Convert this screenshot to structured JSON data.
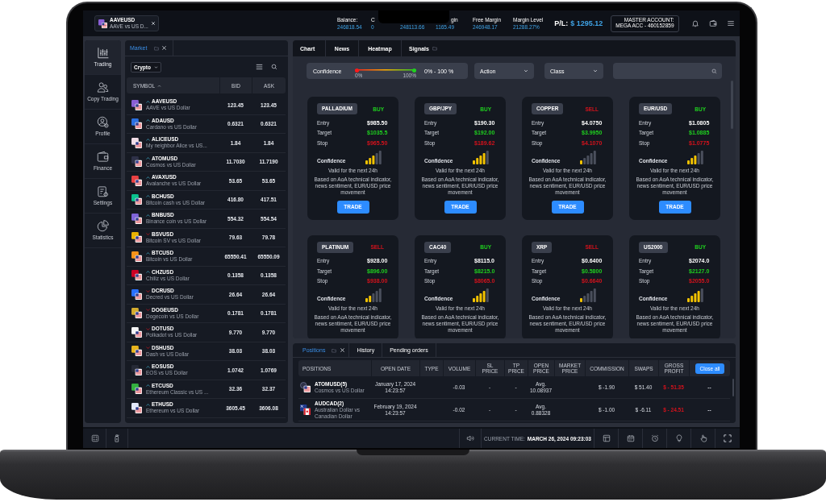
{
  "header": {
    "symbol_tab": {
      "symbol": "AAVEUSD",
      "description": "AAVE vs US D..."
    },
    "stats": [
      {
        "label": "Balance:",
        "value": "246818.54"
      },
      {
        "label": "C",
        "value": "0"
      },
      {
        "value": "248113.66"
      },
      {
        "label": "gin",
        "value": "1165.49"
      },
      {
        "label": "Free Margin",
        "value": "246948.17"
      },
      {
        "label": "Margin Level",
        "value": "21288.27%"
      }
    ],
    "pl": {
      "label": "P/L:",
      "value": "$ 1295.12"
    },
    "account": {
      "caption": "MASTER ACCOUNT:",
      "name": "MEGA ACC - 460152859"
    }
  },
  "sidebar": {
    "items": [
      {
        "label": "Trading",
        "selected": true
      },
      {
        "label": "Copy Trading",
        "selected": false
      },
      {
        "label": "Profile",
        "selected": false
      },
      {
        "label": "Finance",
        "selected": false
      },
      {
        "label": "Settings",
        "selected": false
      },
      {
        "label": "Statistics",
        "selected": false
      }
    ]
  },
  "market": {
    "tabs": [
      {
        "label": "Market",
        "selected": true
      }
    ],
    "filter": {
      "value": "Crypto"
    },
    "columns": [
      "SYMBOL",
      "BID",
      "ASK"
    ],
    "rows": [
      {
        "symbol": "AAVEUSD",
        "description": "AAVE vs US Dollar",
        "rising": true,
        "bid": "123.45",
        "ask": "123.45",
        "color": "#8a5fd6"
      },
      {
        "symbol": "ADAUSD",
        "description": "Cardano vs US Dollar",
        "rising": true,
        "bid": "0.6321",
        "ask": "0.6321",
        "color": "#2a6fe0"
      },
      {
        "symbol": "ALICEUSD",
        "description": "My neighbor Alice vs US...",
        "rising": true,
        "bid": "1.84",
        "ask": "1.84",
        "color": "#f2dde6"
      },
      {
        "symbol": "ATOMUSD",
        "description": "Cosmos vs US Dollar",
        "rising": true,
        "bid": "11.7030",
        "ask": "11.7190",
        "color": "#2e3148"
      },
      {
        "symbol": "AVAXUSD",
        "description": "Avalanche vs US Dollar",
        "rising": true,
        "bid": "53.65",
        "ask": "53.65",
        "color": "#e84142"
      },
      {
        "symbol": "BCHUSD",
        "description": "Bitcoin cash vs US Dollar",
        "rising": true,
        "bid": "416.80",
        "ask": "417.51",
        "color": "#0ac18e"
      },
      {
        "symbol": "BNBUSD",
        "description": "Binance coin vs US Dollar",
        "rising": true,
        "bid": "554.32",
        "ask": "554.54",
        "color": "#7f64d8"
      },
      {
        "symbol": "BSVUSD",
        "description": "Bitcoin SV vs US Dollar",
        "rising": false,
        "bid": "79.63",
        "ask": "79.78",
        "color": "#eab300"
      },
      {
        "symbol": "BTCUSD",
        "description": "Bitcoin vs US Dollar",
        "rising": true,
        "bid": "65550.41",
        "ask": "65550.09",
        "color": "#f7931a"
      },
      {
        "symbol": "CHZUSD",
        "description": "Chiliz vs US Dollar",
        "rising": true,
        "bid": "0.1358",
        "ask": "0.1358",
        "color": "#cd0124"
      },
      {
        "symbol": "DCRUSD",
        "description": "Decred vs US Dollar",
        "rising": false,
        "bid": "26.64",
        "ask": "26.64",
        "color": "#2970ff"
      },
      {
        "symbol": "DOGEUSD",
        "description": "Dogecoin vs US Dollar",
        "rising": false,
        "bid": "0.1781",
        "ask": "0.1781",
        "color": "#d4ac2f"
      },
      {
        "symbol": "DOTUSD",
        "description": "Polkadot vs US Dollar",
        "rising": false,
        "bid": "9.770",
        "ask": "9.770",
        "color": "#f4f4f4"
      },
      {
        "symbol": "DSHUSD",
        "description": "Dash vs US Dollar",
        "rising": false,
        "bid": "38.03",
        "ask": "38.03",
        "color": "#e8b41c"
      },
      {
        "symbol": "EOSUSD",
        "description": "EOS vs US Dollar",
        "rising": true,
        "bid": "1.0742",
        "ask": "1.0769",
        "color": "#262a36"
      },
      {
        "symbol": "ETCUSD",
        "description": "Ethereum Classic vs US ...",
        "rising": true,
        "bid": "32.36",
        "ask": "32.37",
        "color": "#33b03f"
      },
      {
        "symbol": "ETHUSD",
        "description": "Ethereum vs US Dollar",
        "rising": true,
        "bid": "3605.45",
        "ask": "3606.08",
        "color": "#e3e9fb"
      }
    ]
  },
  "signals": {
    "tabs": [
      {
        "label": "Chart",
        "selected": false
      },
      {
        "label": "News",
        "selected": false
      },
      {
        "label": "Heatmap",
        "selected": false
      },
      {
        "label": "Signals",
        "selected": true
      }
    ],
    "filters": {
      "confidence": {
        "label": "Confidence",
        "min_label": "0%",
        "max_label": "100%",
        "range": "0% - 100 %"
      },
      "action": {
        "value": "Action"
      },
      "class": {
        "value": "Class"
      }
    },
    "cards": [
      {
        "instrument": "PALLADIUM",
        "action": "BUY",
        "buy": true,
        "rows": [
          {
            "kind": "entry",
            "label": "Entry",
            "value": "$985.50"
          },
          {
            "kind": "target",
            "label": "Target",
            "value": "$1035.5"
          },
          {
            "kind": "stop",
            "label": "Stop",
            "value": "$965.50"
          }
        ],
        "confidence_label": "Confidence",
        "level": 0.6,
        "validity": "Valid for the next 24h",
        "basis": "Based on AoA technical indicator, news sentiment, EUR/USD price movement",
        "button": "TRADE"
      },
      {
        "instrument": "GBP/JPY",
        "action": "BUY",
        "buy": true,
        "rows": [
          {
            "kind": "entry",
            "label": "Entry",
            "value": "$190.30"
          },
          {
            "kind": "target",
            "label": "Target",
            "value": "$192.00"
          },
          {
            "kind": "stop",
            "label": "Stop",
            "value": "$189.62"
          }
        ],
        "confidence_label": "Confidence",
        "level": 0.8,
        "validity": "Valid for the next 24h",
        "basis": "Based on AoA technical indicator, news sentiment, EUR/USD price movement",
        "button": "TRADE"
      },
      {
        "instrument": "COPPER",
        "action": "SELL",
        "buy": false,
        "rows": [
          {
            "kind": "entry",
            "label": "Entry",
            "value": "$4.0750"
          },
          {
            "kind": "target",
            "label": "Target",
            "value": "$3.9950"
          },
          {
            "kind": "stop",
            "label": "Stop",
            "value": "$4.1070"
          }
        ],
        "confidence_label": "Confidence",
        "level": 0.2,
        "validity": "Valid for the next 24h",
        "basis": "Based on AoA technical indicator, news sentiment, EUR/USD price movement",
        "button": "TRADE"
      },
      {
        "instrument": "EUR/USD",
        "action": "BUY",
        "buy": true,
        "rows": [
          {
            "kind": "entry",
            "label": "Entry",
            "value": "$1.0805"
          },
          {
            "kind": "target",
            "label": "Target",
            "value": "$1.0885"
          },
          {
            "kind": "stop",
            "label": "Stop",
            "value": "$1.0775"
          }
        ],
        "confidence_label": "Confidence",
        "level": 0.6,
        "validity": "Valid for the next 24h",
        "basis": "Based on AoA technical indicator, news sentiment, EUR/USD price movement",
        "button": "TRADE"
      },
      {
        "instrument": "PLATINUM",
        "action": "SELL",
        "buy": false,
        "rows": [
          {
            "kind": "entry",
            "label": "Entry",
            "value": "$928.00"
          },
          {
            "kind": "target",
            "label": "Target",
            "value": "$896.00"
          },
          {
            "kind": "stop",
            "label": "Stop",
            "value": "$938.00"
          }
        ],
        "confidence_label": "Confidence",
        "level": 0.4,
        "validity": "Valid for the next 24h",
        "basis": "Based on AoA technical indicator, news sentiment, EUR/USD price movement"
      },
      {
        "instrument": "CAC40",
        "action": "BUY",
        "buy": true,
        "rows": [
          {
            "kind": "entry",
            "label": "Entry",
            "value": "$8115.0"
          },
          {
            "kind": "target",
            "label": "Target",
            "value": "$8215.0"
          },
          {
            "kind": "stop",
            "label": "Stop",
            "value": "$8065.0"
          }
        ],
        "confidence_label": "Confidence",
        "level": 0.8,
        "validity": "Valid for the next 24h",
        "basis": "Based on AoA technical indicator, news sentiment, EUR/USD price movement"
      },
      {
        "instrument": "XRP",
        "action": "SELL",
        "buy": false,
        "rows": [
          {
            "kind": "entry",
            "label": "Entry",
            "value": "$0.6400"
          },
          {
            "kind": "target",
            "label": "Target",
            "value": "$0.5800"
          },
          {
            "kind": "stop",
            "label": "Stop",
            "value": "$0.6640"
          }
        ],
        "confidence_label": "Confidence",
        "level": 0.2,
        "validity": "Valid for the next 24h",
        "basis": "Based on AoA technical indicator, news sentiment, EUR/USD price movement"
      },
      {
        "instrument": "US2000",
        "action": "BUY",
        "buy": true,
        "rows": [
          {
            "kind": "entry",
            "label": "Entry",
            "value": "$2074.0"
          },
          {
            "kind": "target",
            "label": "Target",
            "value": "$2127.0"
          },
          {
            "kind": "stop",
            "label": "Stop",
            "value": "$2055.0"
          }
        ],
        "confidence_label": "Confidence",
        "level": 0.8,
        "validity": "Valid for the next 24h",
        "basis": "Based on AoA technical indicator, news sentiment, EUR/USD price movement"
      }
    ]
  },
  "positions": {
    "tabs": [
      {
        "label": "Positions",
        "selected": true
      },
      {
        "label": "History",
        "selected": false
      },
      {
        "label": "Pending orders",
        "selected": false
      }
    ],
    "columns": [
      "POSITIONS",
      "OPEN DATE",
      "TYPE",
      "VOLUME",
      "SL PRICE",
      "TP PRICE",
      "OPEN PRICE",
      "MARKET PRICE",
      "COMMISSION",
      "SWAPS",
      "GROSS PROFIT"
    ],
    "close_all": "Close all",
    "rows": [
      {
        "symbol": "ATOMUSD(5)",
        "description": "Cosmos vs US Dollar",
        "open_date": "January 17, 2024",
        "open_time": "14:23:57",
        "volume": "-0.03",
        "sl_price": "-",
        "tp_price": "-",
        "open_price_caption": "Avg.",
        "open_price": "10.08937",
        "commission": "$ -1.90",
        "swaps": "$ 51.40",
        "gross_profit": "$ - 51.35",
        "loss": true,
        "more": "--"
      },
      {
        "symbol": "AUDCAD(2)",
        "description": "Australian Dollar vs Canadian Dollar",
        "open_date": "February 19, 2024",
        "open_time": "14:23:57",
        "volume": "-0.02",
        "sl_price": "-",
        "tp_price": "-",
        "open_price_caption": "Avg.",
        "open_price": "0.88328",
        "commission": "$ -1.00",
        "swaps": "$ -6.11",
        "gross_profit": "$ - 24.51",
        "loss": true,
        "more": "--"
      }
    ]
  },
  "status_bar": {
    "time_label": "CURRENT TIME:",
    "time": "MARCH 26, 2024 09:23:03"
  }
}
